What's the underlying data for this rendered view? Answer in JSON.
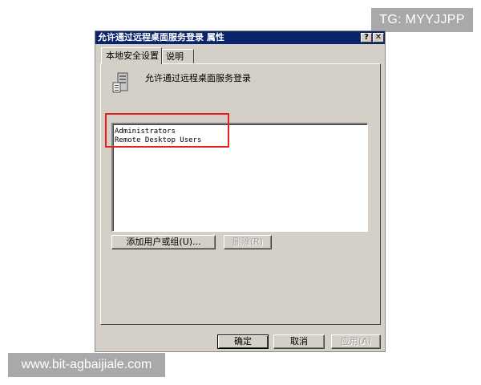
{
  "watermarks": {
    "top": "TG: MYYJJPP",
    "bottom": "www.bit-agbaijiale.com"
  },
  "dialog": {
    "title": "允许通过远程桌面服务登录 属性",
    "help_label": "?",
    "close_label": "✕",
    "tabs": [
      {
        "label": "本地安全设置",
        "active": true
      },
      {
        "label": "说明",
        "active": false
      }
    ],
    "policy_name": "允许通过远程桌面服务登录",
    "members": [
      "Administrators",
      "Remote Desktop Users"
    ],
    "buttons": {
      "add": "添加用户或组(U)...",
      "remove": "删除(R)",
      "ok": "确定",
      "cancel": "取消",
      "apply": "应用(A)"
    }
  },
  "colors": {
    "titlebar": "#0a246a",
    "face": "#d4d0c8",
    "highlight": "#e8201c"
  },
  "icons": {
    "policy": "server-policy-icon",
    "help": "help-icon",
    "close": "close-icon"
  }
}
